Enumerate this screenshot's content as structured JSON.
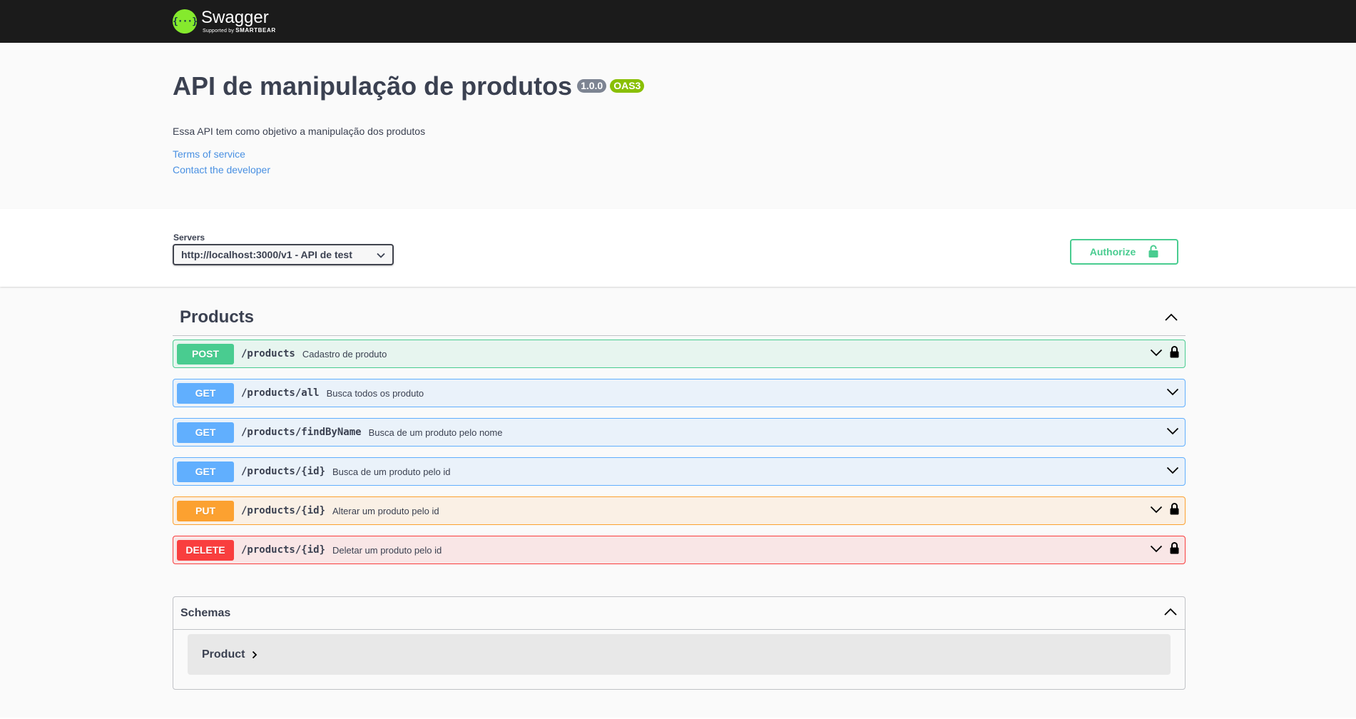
{
  "topbar": {
    "logo_icon": "swagger-logo-icon",
    "logo_glyph": "{···}",
    "brand": "Swagger",
    "supported_by": "Supported by",
    "smartbear": "SMARTBEAR"
  },
  "info": {
    "title": "API de manipulação de produtos",
    "version": "1.0.0",
    "oas": "OAS3",
    "description": "Essa API tem como objetivo a manipulação dos produtos",
    "terms_link": "Terms of service",
    "contact_link": "Contact the developer"
  },
  "servers": {
    "label": "Servers",
    "selected": "http://localhost:3000/v1 - API de test"
  },
  "authorize": {
    "label": "Authorize",
    "icon": "lock-open-icon"
  },
  "products": {
    "title": "Products",
    "operations": [
      {
        "method": "POST",
        "path": "/products",
        "summary": "Cadastro de produto",
        "locked": true
      },
      {
        "method": "GET",
        "path": "/products/all",
        "summary": "Busca todos os produto",
        "locked": false
      },
      {
        "method": "GET",
        "path": "/products/findByName",
        "summary": "Busca de um produto pelo nome",
        "locked": false
      },
      {
        "method": "GET",
        "path": "/products/{id}",
        "summary": "Busca de um produto pelo id",
        "locked": false
      },
      {
        "method": "PUT",
        "path": "/products/{id}",
        "summary": "Alterar um produto pelo id",
        "locked": true
      },
      {
        "method": "DELETE",
        "path": "/products/{id}",
        "summary": "Deletar um produto pelo id",
        "locked": true
      }
    ]
  },
  "schemas": {
    "title": "Schemas",
    "models": [
      {
        "name": "Product"
      }
    ]
  },
  "colors": {
    "post": "#49cc90",
    "get": "#61affe",
    "put": "#fca130",
    "delete": "#f93e3e",
    "topbar": "#1b1b1b",
    "logo": "#85ea2d"
  }
}
